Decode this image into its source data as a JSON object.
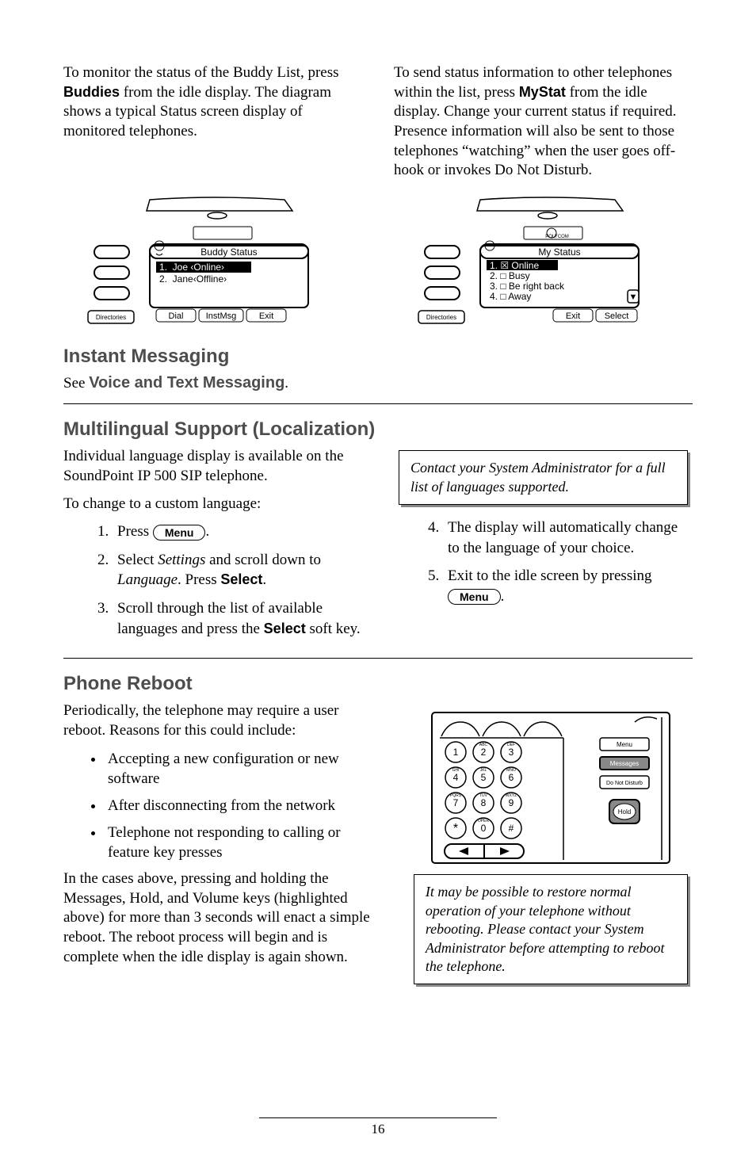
{
  "intro": {
    "left_p": "To monitor the status of the Buddy List, press ",
    "buddies_label": "Buddies",
    "left_p2": " from the idle display.  The diagram shows a typical Status screen display of monitored telephones.",
    "right_p": "To send status information to other telephones within the list, press ",
    "mystat_label": "MyStat",
    "right_p2": " from the idle display.  Change your current status if required.  Presence information will also be sent to those telephones “watching” when the user goes off-hook or invokes Do Not Disturb."
  },
  "fig_buddy": {
    "title": "Buddy Status",
    "line1": "1.  Joe ‹Online›",
    "line2": "2.  Jane‹Offline›",
    "soft1": "Dial",
    "soft2": "InstMsg",
    "soft3": "Exit",
    "dir": "Directories"
  },
  "fig_mystat": {
    "title": "My Status",
    "line1": "1. ☒ Online",
    "line2": "2. □ Busy",
    "line3": "3. □ Be right back",
    "line4": "4. □ Away",
    "soft1": "Exit",
    "soft2": "Select",
    "dir": "Directories"
  },
  "instant": {
    "heading": "Instant Messaging",
    "see": "See ",
    "link": "Voice and Text Messaging",
    "dot": "."
  },
  "multi": {
    "heading": "Multilingual Support (Localization)",
    "p1": "Individual language display is available on the SoundPoint IP 500 SIP telephone.",
    "p2": "To change to a custom language:",
    "step1a": "Press ",
    "menu_label": "Menu",
    "step1b": ".",
    "step2a": "Select ",
    "step2b": "Settings",
    "step2c": " and scroll down to ",
    "step2d": "Language",
    "step2e": ".  Press ",
    "select_label": "Select",
    "step2f": ".",
    "step3a": "Scroll through the list of available languages and press the ",
    "step3b": " soft key.",
    "note": "Contact your System Administrator for a full list of languages supported.",
    "step4": "The display will automatically change to the language of your choice.",
    "step5a": "Exit to the idle screen by pressing ",
    "step5b": "."
  },
  "reboot": {
    "heading": "Phone Reboot",
    "p1": "Periodically, the telephone may require a user reboot.  Reasons for this could include:",
    "b1": "Accepting a new configuration or new software",
    "b2": "After disconnecting from the network",
    "b3": "Telephone not responding to calling or feature key presses",
    "p2": "In the cases above, pressing and holding the Messages, Hold, and Volume keys (highlighted above) for more than 3 seconds will enact a simple reboot.  The reboot process will begin and is complete when the idle display is again shown.",
    "note": "It may be possible to restore normal operation of your telephone without rebooting.  Please contact your System Administrator before attempting to reboot the telephone.",
    "keypad_menu": "Menu",
    "keypad_msg": "Messages",
    "keypad_dnd": "Do Not Disturb",
    "keypad_hold": "Hold"
  },
  "chart_data": {
    "type": "table",
    "note": "no chart present"
  },
  "page_no": "16"
}
